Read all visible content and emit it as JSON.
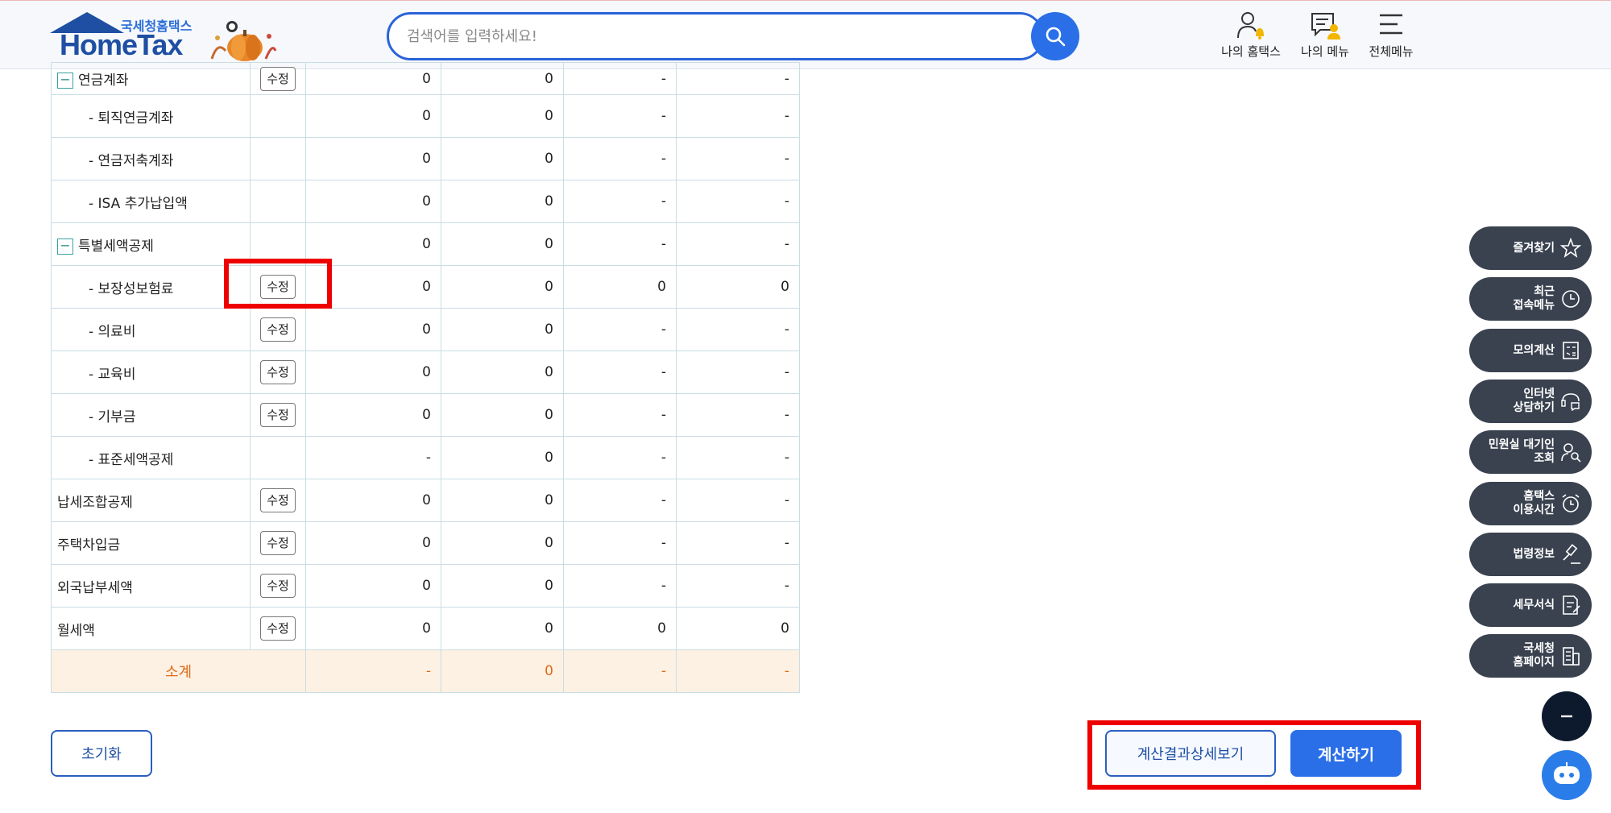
{
  "header": {
    "logo_sub": "국세청홈택스",
    "logo_main": "HomeTax",
    "search_placeholder": "검색어를 입력하세요!",
    "my_hometax": "나의 홈택스",
    "my_menu": "나의 메뉴",
    "all_menu": "전체메뉴"
  },
  "table": {
    "edit_label": "수정",
    "rows": [
      {
        "name": "연금계좌",
        "c1": "0",
        "c2": "0",
        "c3": "-",
        "c4": "-"
      },
      {
        "name": "- 퇴직연금계좌",
        "c1": "0",
        "c2": "0",
        "c3": "-",
        "c4": "-"
      },
      {
        "name": "- 연금저축계좌",
        "c1": "0",
        "c2": "0",
        "c3": "-",
        "c4": "-"
      },
      {
        "name": "- ISA 추가납입액",
        "c1": "0",
        "c2": "0",
        "c3": "-",
        "c4": "-"
      },
      {
        "name": "특별세액공제",
        "c1": "0",
        "c2": "0",
        "c3": "-",
        "c4": "-"
      },
      {
        "name": "- 보장성보험료",
        "c1": "0",
        "c2": "0",
        "c3": "0",
        "c4": "0"
      },
      {
        "name": "- 의료비",
        "c1": "0",
        "c2": "0",
        "c3": "-",
        "c4": "-"
      },
      {
        "name": "- 교육비",
        "c1": "0",
        "c2": "0",
        "c3": "-",
        "c4": "-"
      },
      {
        "name": "- 기부금",
        "c1": "0",
        "c2": "0",
        "c3": "-",
        "c4": "-"
      },
      {
        "name": "- 표준세액공제",
        "c1": "-",
        "c2": "0",
        "c3": "-",
        "c4": "-"
      },
      {
        "name": "납세조합공제",
        "c1": "0",
        "c2": "0",
        "c3": "-",
        "c4": "-"
      },
      {
        "name": "주택차입금",
        "c1": "0",
        "c2": "0",
        "c3": "-",
        "c4": "-"
      },
      {
        "name": "외국납부세액",
        "c1": "0",
        "c2": "0",
        "c3": "-",
        "c4": "-"
      },
      {
        "name": "월세액",
        "c1": "0",
        "c2": "0",
        "c3": "0",
        "c4": "0"
      }
    ],
    "total": {
      "name": "소계",
      "c1": "-",
      "c2": "0",
      "c3": "-",
      "c4": "-"
    }
  },
  "buttons": {
    "reset": "초기화",
    "detail": "계산결과상세보기",
    "calc": "계산하기"
  },
  "side_menu": [
    {
      "line1": "즐겨찾기",
      "line2": "",
      "icon": "star-icon"
    },
    {
      "line1": "최근",
      "line2": "접속메뉴",
      "icon": "clock-icon"
    },
    {
      "line1": "모의계산",
      "line2": "",
      "icon": "calculator-icon"
    },
    {
      "line1": "인터넷",
      "line2": "상담하기",
      "icon": "chat-support-icon"
    },
    {
      "line1": "민원실 대기인",
      "line2": "조회",
      "icon": "person-search-icon"
    },
    {
      "line1": "홈택스",
      "line2": "이용시간",
      "icon": "alarm-clock-icon"
    },
    {
      "line1": "법령정보",
      "line2": "",
      "icon": "gavel-icon"
    },
    {
      "line1": "세무서식",
      "line2": "",
      "icon": "document-edit-icon"
    },
    {
      "line1": "국세청",
      "line2": "홈페이지",
      "icon": "building-icon"
    }
  ],
  "colors": {
    "primary": "#2a6fe8",
    "highlight": "#ee0000",
    "total_bg": "#fdf1e3",
    "total_text": "#e06a1a",
    "side_bg": "#3a4250"
  }
}
